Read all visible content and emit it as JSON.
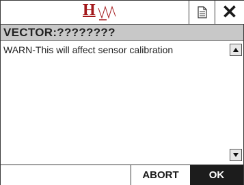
{
  "header": {
    "logo_text": "H",
    "document_icon": "document-icon",
    "close_label": "✕"
  },
  "title": {
    "text": "VECTOR:????????"
  },
  "content": {
    "message": "WARN-This will affect sensor calibration"
  },
  "scrollbar": {
    "up_icon": "arrow-up-icon",
    "down_icon": "arrow-down-icon"
  },
  "footer": {
    "abort_label": "ABORT",
    "ok_label": "OK"
  },
  "colors": {
    "logo_red": "#a3181b",
    "title_bar": "#c8c8c8",
    "ok_bg": "#1c1c1c"
  }
}
